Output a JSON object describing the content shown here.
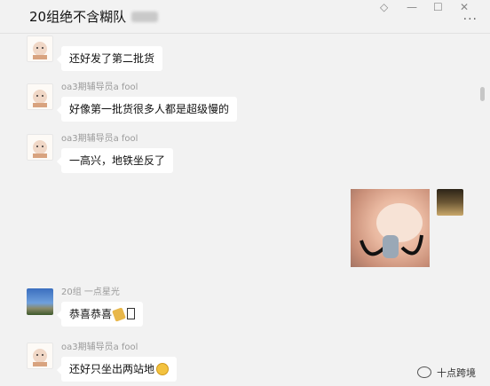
{
  "window": {
    "title": "20组绝不含糊队",
    "more_label": "···",
    "pin_icon": "pin-icon",
    "min_icon": "minimize-icon",
    "max_icon": "maximize-icon",
    "close_icon": "close-icon"
  },
  "messages": [
    {
      "sender": "",
      "text": "还好发了第二批货",
      "avatar": "pig-avatar"
    },
    {
      "sender": "oa3期辅导员a fool",
      "text": "好像第一批货很多人都是超级慢的",
      "avatar": "pig-avatar"
    },
    {
      "sender": "oa3期辅导员a fool",
      "text": "一高兴，地铁坐反了",
      "avatar": "pig-avatar"
    },
    {
      "sender": "",
      "text": "",
      "avatar": "self-avatar",
      "sticker": "laughing-pig-sticker"
    },
    {
      "sender": "20组 一点星光",
      "text": "恭喜恭喜",
      "emoji": [
        "party-popper-icon",
        "unknown-glyph-box"
      ],
      "avatar": "sky-avatar"
    },
    {
      "sender": "oa3期辅导员a fool",
      "text": "还好只坐出两站地",
      "emoji": [
        "crying-face-icon"
      ],
      "avatar": "pig-avatar"
    }
  ],
  "watermark": {
    "text": "十点跨境",
    "icon": "wechat-icon"
  },
  "colors": {
    "background": "#f2f2f2",
    "bubble": "#ffffff",
    "sender": "#9a9a9a"
  }
}
